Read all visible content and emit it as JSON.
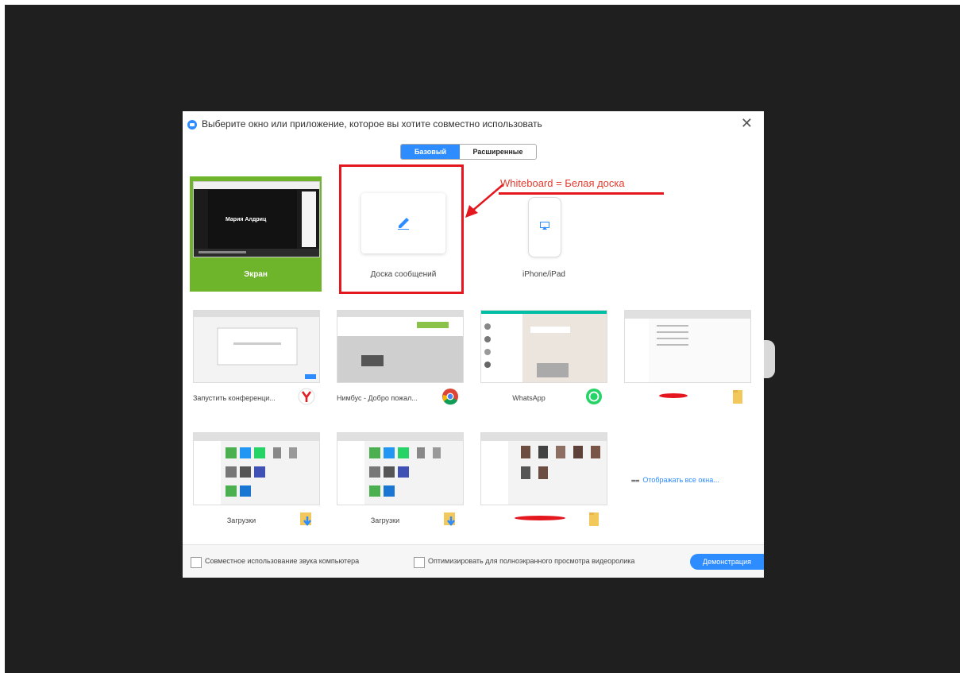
{
  "dialog": {
    "title": "Выберите окно или приложение, которое вы хотите совместно использовать",
    "close_icon": "close-icon"
  },
  "tabs": [
    {
      "label": "Базовый",
      "active": true
    },
    {
      "label": "Расширенные",
      "active": false
    }
  ],
  "tiles": {
    "screen": {
      "label": "Экран",
      "screen_text": "Мария Алдриц"
    },
    "whiteboard": {
      "label": "Доска сообщений",
      "icon": "pencil-icon"
    },
    "iphone": {
      "label": "iPhone/iPad",
      "icon": "airplay-icon"
    }
  },
  "annotation": {
    "text": "Whiteboard = Белая доска"
  },
  "windows": [
    {
      "label": "Запустить конференци...",
      "icon": "yandex-browser-icon"
    },
    {
      "label": "Нимбус - Добро пожал...",
      "icon": "chrome-icon"
    },
    {
      "label": "WhatsApp",
      "icon": "whatsapp-icon"
    },
    {
      "label": "",
      "icon": "folder-icon"
    },
    {
      "label": "Загрузки",
      "icon": "downloads-folder-icon"
    },
    {
      "label": "Загрузки",
      "icon": "downloads-folder-icon"
    },
    {
      "label": "",
      "icon": "folder-icon"
    }
  ],
  "show_all": {
    "label": "Отображать все окна..."
  },
  "footer": {
    "share_sound": "Совместное использование звука компьютера",
    "optimize_video": "Оптимизировать для полноэкранного просмотра видеоролика",
    "share_button": "Демонстрация"
  },
  "colors": {
    "accent": "#2d8cff",
    "selected": "#6fb52c",
    "highlight": "#e4171f"
  }
}
